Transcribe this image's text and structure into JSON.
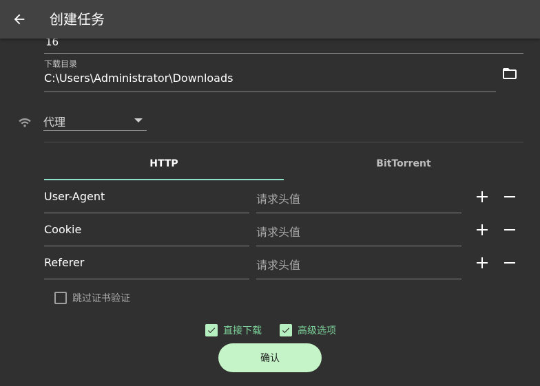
{
  "appbar": {
    "title": "创建任务",
    "back_icon": "arrow-left-icon"
  },
  "partial_field": {
    "value": "16"
  },
  "download_dir": {
    "label": "下载目录",
    "value": "C:\\Users\\Administrator\\Downloads",
    "folder_icon": "folder-icon"
  },
  "proxy": {
    "icon": "wifi-icon",
    "label": "代理"
  },
  "tabs": [
    {
      "label": "HTTP",
      "active": true
    },
    {
      "label": "BitTorrent",
      "active": false
    }
  ],
  "headers": [
    {
      "key": "User-Agent",
      "value_placeholder": "请求头值"
    },
    {
      "key": "Cookie",
      "value_placeholder": "请求头值"
    },
    {
      "key": "Referer",
      "value_placeholder": "请求头值"
    }
  ],
  "skip_cert": {
    "label": "跳过证书验证",
    "checked": false
  },
  "direct_download": {
    "label": "直接下载",
    "checked": true
  },
  "advanced_options": {
    "label": "高级选项",
    "checked": true
  },
  "confirm": {
    "label": "确认"
  },
  "colors": {
    "accent": "#8ee0c8",
    "check": "#b7f0c0",
    "background": "#303030",
    "appbar": "#424242"
  }
}
